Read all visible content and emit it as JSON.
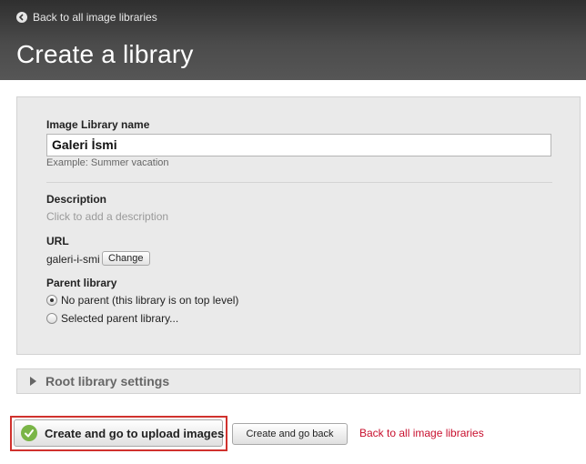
{
  "header": {
    "back_link_label": "Back to all image libraries",
    "title": "Create a library",
    "back_icon": "arrow-left-circle-icon"
  },
  "form": {
    "name": {
      "label": "Image Library name",
      "value": "Galeri İsmi",
      "hint": "Example: Summer vacation"
    },
    "description": {
      "label": "Description",
      "placeholder": "Click to add a description"
    },
    "url": {
      "label": "URL",
      "value": "galeri-i-smi",
      "change_label": "Change"
    },
    "parent_library": {
      "label": "Parent library",
      "options": [
        {
          "label": "No parent (this library is on top level)",
          "checked": true
        },
        {
          "label": "Selected parent library...",
          "checked": false
        }
      ]
    }
  },
  "root_settings": {
    "label": "Root library settings",
    "icon": "triangle-right-icon"
  },
  "actions": {
    "primary_label": "Create and go to upload images",
    "primary_icon": "checkmark-circle-icon",
    "secondary_label": "Create and go back",
    "cancel_label": "Back to all image libraries"
  },
  "colors": {
    "header_bg": "#3a3a3a",
    "panel_bg": "#eaeaea",
    "highlight_border": "#d0312d",
    "link_red": "#c8102e",
    "check_green": "#7ab547"
  }
}
